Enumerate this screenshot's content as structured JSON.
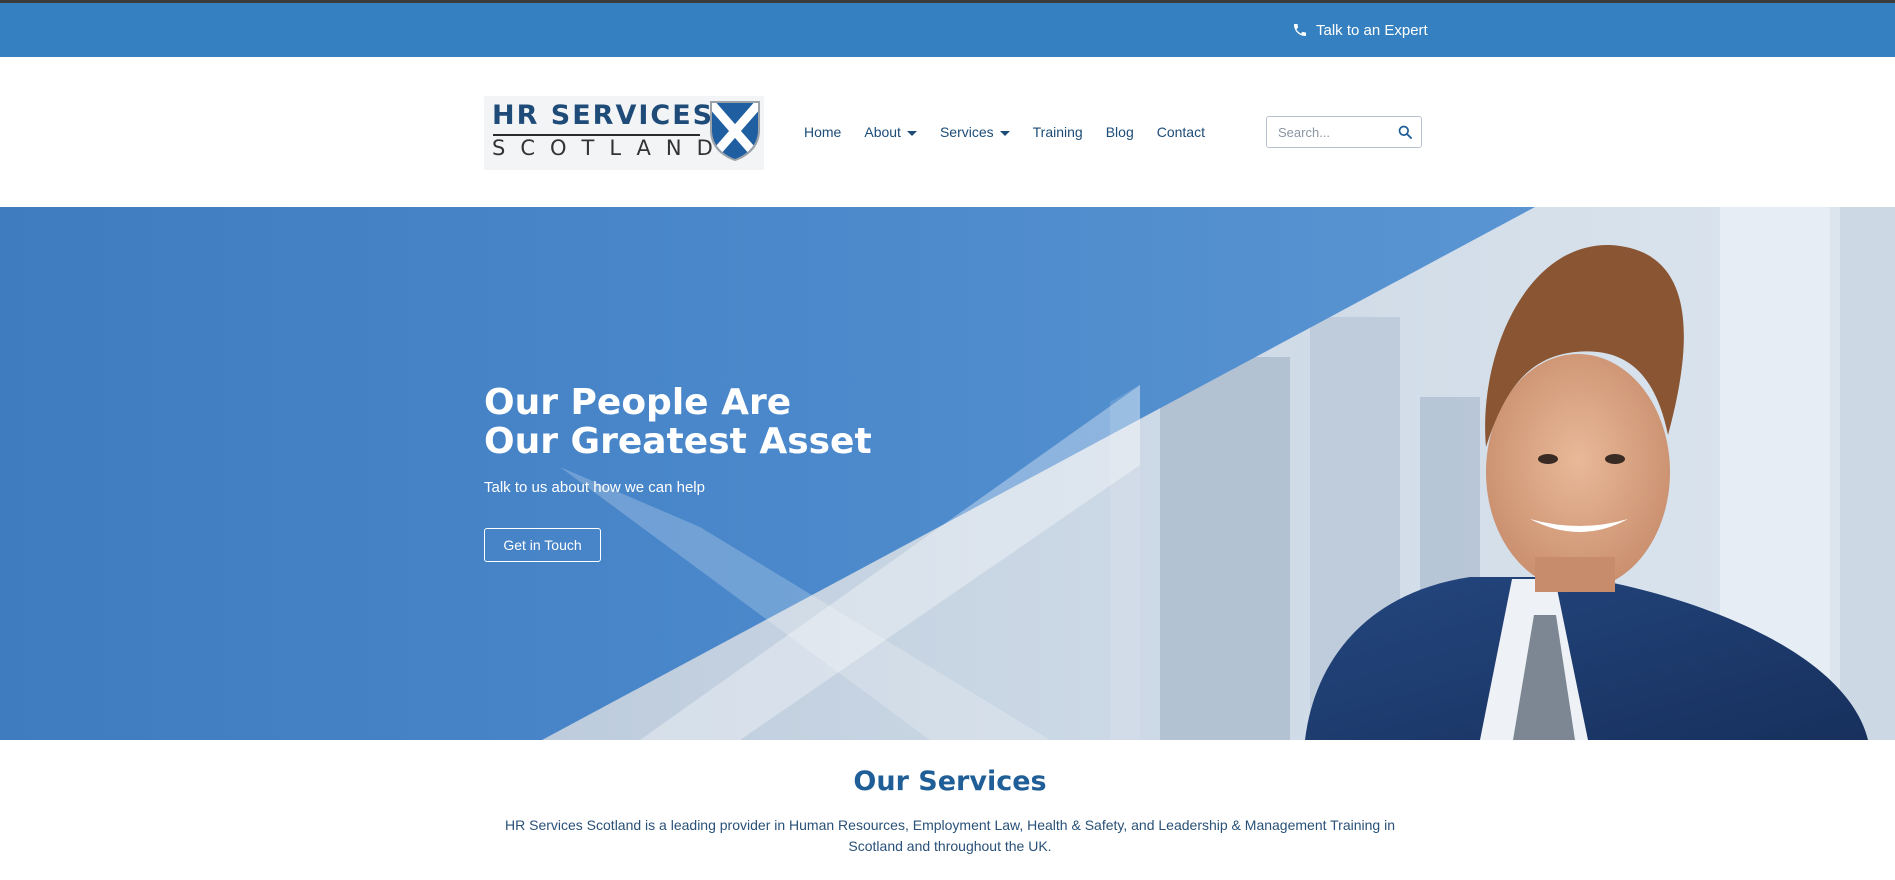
{
  "colors": {
    "topbar": "#3580c0",
    "hero_blue": "#4682c7",
    "nav_text": "#1c4c77",
    "heading": "#1f5e96"
  },
  "topbar": {
    "icon": "phone-icon",
    "cta_label": "Talk to an Expert"
  },
  "logo": {
    "line1": "HR SERVICES",
    "line2": "SCOTLAND",
    "emblem": "saltire-shield-icon"
  },
  "nav": {
    "items": [
      {
        "label": "Home",
        "dropdown": false
      },
      {
        "label": "About",
        "dropdown": true
      },
      {
        "label": "Services",
        "dropdown": true
      },
      {
        "label": "Training",
        "dropdown": false
      },
      {
        "label": "Blog",
        "dropdown": false
      },
      {
        "label": "Contact",
        "dropdown": false
      }
    ]
  },
  "search": {
    "placeholder": "Search...",
    "value": "",
    "icon": "search-icon"
  },
  "hero": {
    "title_line1": "Our People Are",
    "title_line2": "Our Greatest Asset",
    "subtitle": "Talk to us about how we can help",
    "button_label": "Get in Touch"
  },
  "services": {
    "heading": "Our Services",
    "intro": "HR Services Scotland is a leading provider in Human Resources, Employment Law, Health & Safety, and Leadership & Management Training in Scotland and throughout the UK.",
    "more": ""
  }
}
